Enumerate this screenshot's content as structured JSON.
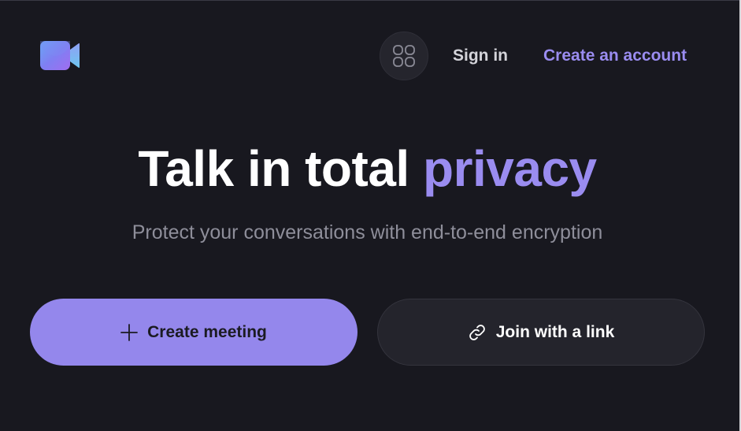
{
  "header": {
    "logo_icon": "video-camera-logo-icon",
    "apps_icon": "apps-grid-icon",
    "sign_in_label": "Sign in",
    "create_account_label": "Create an account"
  },
  "hero": {
    "title_main": "Talk in total ",
    "title_accent": "privacy",
    "subtitle": "Protect your conversations with end-to-end encryption"
  },
  "actions": {
    "create_meeting_label": "Create meeting",
    "create_meeting_icon": "plus-icon",
    "join_label": "Join with a link",
    "join_icon": "link-icon"
  },
  "colors": {
    "background": "#18181f",
    "accent": "#9a8cf0",
    "primary_button": "#9487ec",
    "secondary_button": "#24242c"
  }
}
